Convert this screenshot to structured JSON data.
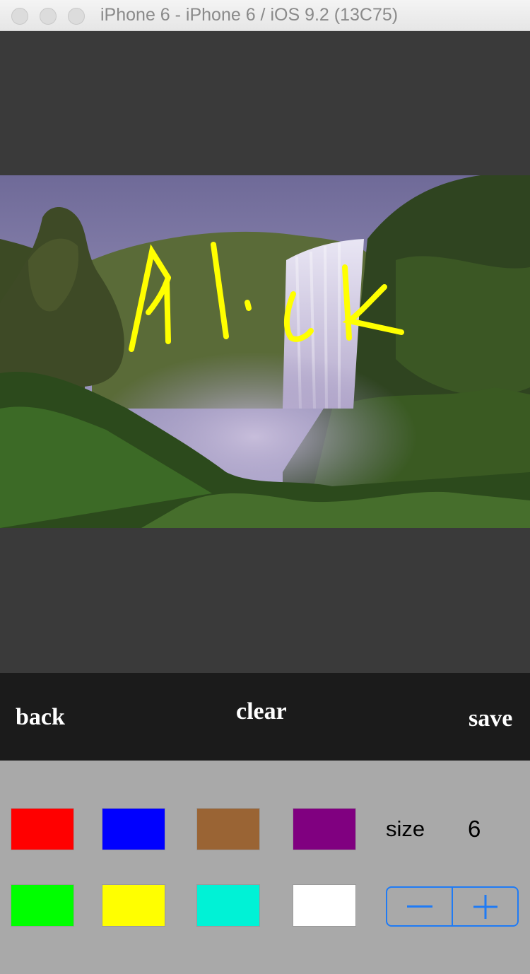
{
  "window": {
    "title": "iPhone 6 - iPhone 6 / iOS 9.2 (13C75)"
  },
  "toolbar": {
    "back_label": "back",
    "clear_label": "clear",
    "save_label": "save"
  },
  "brush": {
    "size_label": "size",
    "size_value": "6",
    "decrement_icon": "minus-icon",
    "increment_icon": "plus-icon",
    "accent_color": "#1f7bf5",
    "stroke_color": "#ffff00"
  },
  "colors": [
    {
      "name": "red",
      "hex": "#ff0000"
    },
    {
      "name": "blue",
      "hex": "#0000ff"
    },
    {
      "name": "brown",
      "hex": "#9a6434"
    },
    {
      "name": "purple",
      "hex": "#800080"
    },
    {
      "name": "green",
      "hex": "#00ff00"
    },
    {
      "name": "yellow",
      "hex": "#ffff00"
    },
    {
      "name": "cyan",
      "hex": "#00f2d6"
    },
    {
      "name": "white",
      "hex": "#ffffff"
    }
  ]
}
